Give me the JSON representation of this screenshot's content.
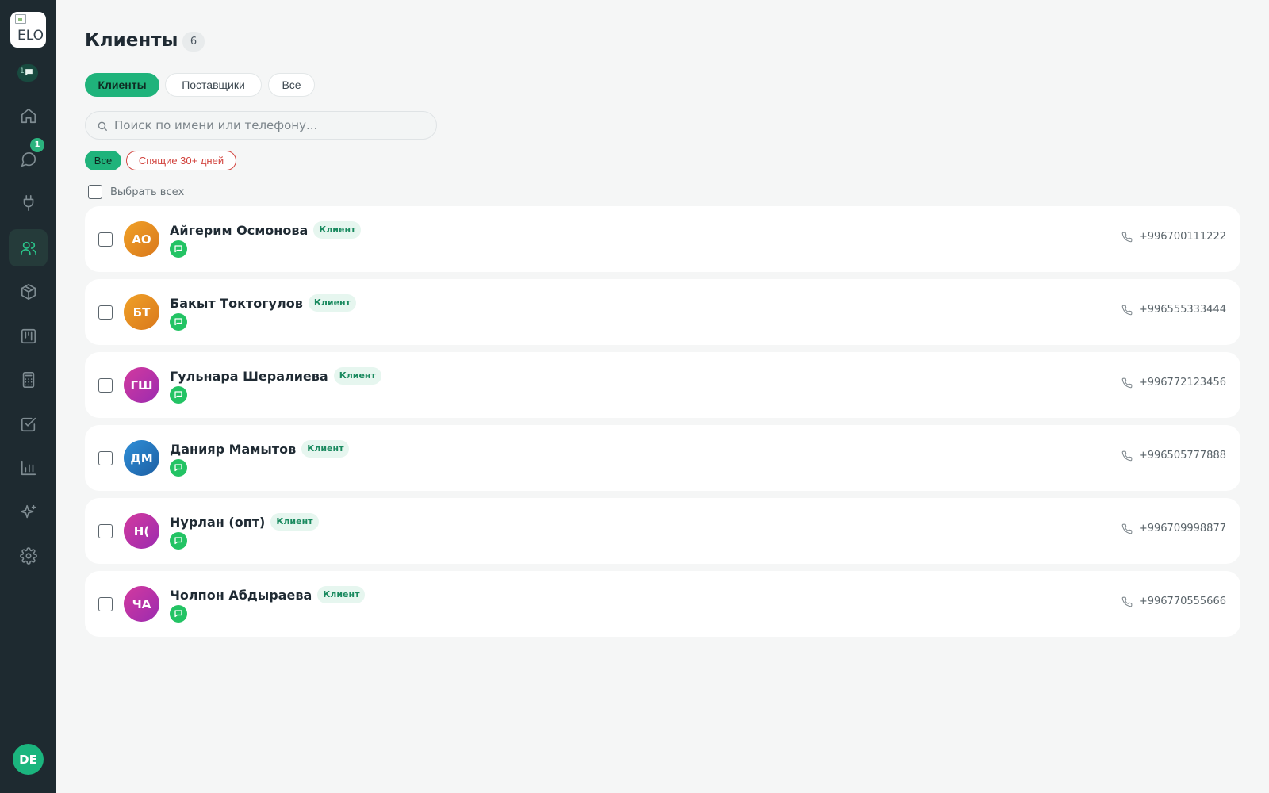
{
  "app": {
    "logo_alt": "ELO",
    "mini_badge_count": "1",
    "user_initials": "DE"
  },
  "sidebar": {
    "items": [
      {
        "icon": "home-icon",
        "active": false
      },
      {
        "icon": "chat-icon",
        "active": false,
        "badge": "1"
      },
      {
        "icon": "plug-icon",
        "active": false
      },
      {
        "icon": "users-icon",
        "active": true
      },
      {
        "icon": "box-icon",
        "active": false
      },
      {
        "icon": "kanban-icon",
        "active": false
      },
      {
        "icon": "calculator-icon",
        "active": false
      },
      {
        "icon": "checklist-icon",
        "active": false
      },
      {
        "icon": "chart-icon",
        "active": false
      },
      {
        "icon": "sparkles-icon",
        "active": false
      },
      {
        "icon": "gear-icon",
        "active": false
      }
    ]
  },
  "header": {
    "title": "Клиенты",
    "count": "6"
  },
  "tabs": [
    {
      "label": "Клиенты",
      "active": true
    },
    {
      "label": "Поставщики",
      "active": false
    },
    {
      "label": "Все",
      "active": false
    }
  ],
  "search": {
    "placeholder": "Поиск по имени или телефону..."
  },
  "filters": {
    "all": "Все",
    "sleeping": "Спящие 30+ дней"
  },
  "select_all_label": "Выбрать всех",
  "clients": [
    {
      "initials": "АО",
      "name": "Айгерим Осмонова",
      "tag": "Клиент",
      "phone": "+996700111222",
      "color_from": "#f0a127",
      "color_to": "#d9781c"
    },
    {
      "initials": "БТ",
      "name": "Бакыт Токтогулов",
      "tag": "Клиент",
      "phone": "+996555333444",
      "color_from": "#f0a127",
      "color_to": "#d9781c"
    },
    {
      "initials": "ГШ",
      "name": "Гульнара Шералиева",
      "tag": "Клиент",
      "phone": "+996772123456",
      "color_from": "#d33a9e",
      "color_to": "#9b2bb0"
    },
    {
      "initials": "ДМ",
      "name": "Данияр Мамытов",
      "tag": "Клиент",
      "phone": "+996505777888",
      "color_from": "#2f8fd8",
      "color_to": "#1d5fa3"
    },
    {
      "initials": "Н(",
      "name": "Нурлан (опт)",
      "tag": "Клиент",
      "phone": "+996709998877",
      "color_from": "#d33a9e",
      "color_to": "#9b2bb0"
    },
    {
      "initials": "ЧА",
      "name": "Чолпон Абдыраева",
      "tag": "Клиент",
      "phone": "+996770555666",
      "color_from": "#d33a9e",
      "color_to": "#9b2bb0"
    }
  ]
}
